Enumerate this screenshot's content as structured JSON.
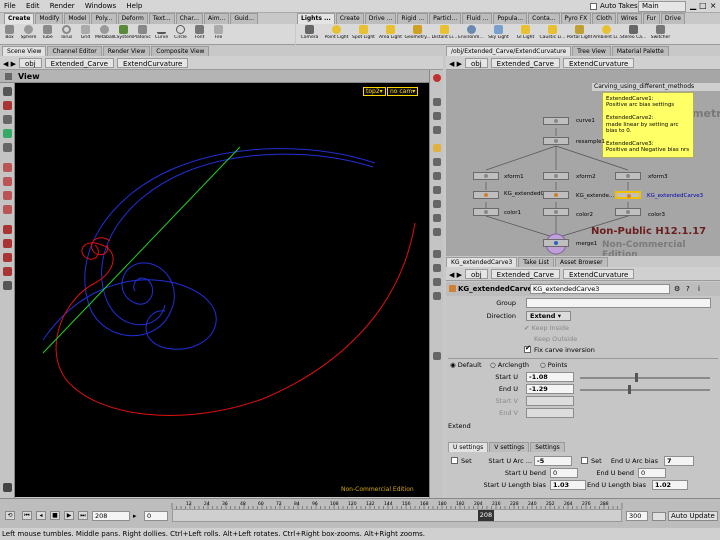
{
  "menu": [
    "File",
    "Edit",
    "Render",
    "Windows",
    "Help"
  ],
  "top_right": {
    "auto_takes": "Auto Takes",
    "desktop": "Main"
  },
  "shelf_tabs_left": [
    "Create",
    "Modify",
    "Model",
    "Poly...",
    "Deform",
    "Text...",
    "Char...",
    "Aim...",
    "Guid..."
  ],
  "shelf_tabs_right": [
    "Lights ...",
    "Create",
    "Drive ...",
    "Rigid ...",
    "Particl...",
    "Fluid ...",
    "Popula...",
    "Conta...",
    "Pyro FX",
    "Cloth",
    "Wires",
    "Fur",
    "Drive"
  ],
  "shelf_tools_left": [
    "Box",
    "Sphere",
    "Tube",
    "Torus",
    "Grid",
    "Metaball",
    "LSystem",
    "Platonic S...",
    "Curve",
    "Circle",
    "Font",
    "File"
  ],
  "shelf_tools_right": [
    "Camera",
    "Point Light",
    "Spot Light",
    "Area Light",
    "Geometry...",
    "Distant Li...",
    "Environm... Light",
    "Sky Light",
    "GI Light",
    "Caustic Li...",
    "Portal Light",
    "Ambient Li...",
    "Stereo Ca... Rig",
    "Switcher"
  ],
  "left_pane": {
    "tabs": [
      "Scene View",
      "Channel Editor",
      "Render View",
      "Composite View"
    ],
    "path": [
      "obj",
      "Extended_Carve",
      "ExtendCurvature"
    ],
    "view_title": "View",
    "camera": "top2▾",
    "no_cam": "no cam▾",
    "watermark": "Non-Commercial Edition"
  },
  "network": {
    "tabs": [
      "/obj/Extended_Carve/ExtendCurvature",
      "Tree View",
      "Material Palette"
    ],
    "path": [
      "obj",
      "Extended_Carve",
      "ExtendCurvature"
    ],
    "title": "Carving_using_different_methods",
    "sticky_note": "ExtendedCarve1:\nPositive arc bias settings\n\nExtendedCarve2:\nmade linear by setting arc bias to 0.\n\nExtendedCarve3:\nPositive and Negative bias nrs",
    "context_label": "Geometry",
    "version_label": "Non-Public H12.1.17",
    "edition_label": "Non-Commercial Edition",
    "node_labels": {
      "curve1": "curve1",
      "resample1": "resample1",
      "xform1": "xform1",
      "xform2": "xform2",
      "xform3": "xform3",
      "carve1": "KG_extendedCarve1",
      "carve2": "KG_extende...",
      "carve3": "KG_extendedCarve3",
      "color1": "color1",
      "color2": "color2",
      "color3": "color3",
      "merge1": "merge1"
    }
  },
  "parm_pane": {
    "tabs": [
      "KG_extendedCarve3",
      "Take List",
      "Asset Browser"
    ],
    "path": [
      "obj",
      "Extended_Carve",
      "ExtendCurvature"
    ],
    "node_type": "KG_extendedCarve",
    "node_name": "KG_extendedCarve3",
    "group_label": "Group",
    "direction_label": "Direction",
    "direction_value": "Extend",
    "keep_inside": "Keep Inside",
    "keep_outside": "Keep Outside",
    "fix_carve": "Fix carve inversion",
    "radio_default": "Default",
    "radio_arclength": "Arclength",
    "radio_points": "Points",
    "start_u_label": "Start U",
    "start_u": "-1.08",
    "end_u_label": "End U",
    "end_u": "-1.29",
    "start_v_label": "Start V",
    "end_v_label": "End V",
    "mode_text": "Extend",
    "subtabs": [
      "U settings",
      "V settings",
      "Settings"
    ],
    "set": "Set",
    "start_u_arc_label": "Start U Arc ...",
    "start_u_arc": "-5",
    "set2": "Set",
    "end_u_arc_label": "End U Arc bias",
    "end_u_arc": "7",
    "start_u_bend_label": "Start U bend",
    "start_u_bend": "0",
    "end_u_bend_label": "End U bend",
    "end_u_bend": "0",
    "start_u_len_label": "Start U Length bias",
    "start_u_len": "1.03",
    "end_u_len_label": "End U Length bias",
    "end_u_len": "1.02"
  },
  "timeline": {
    "frame": "208",
    "start": "0",
    "end": "300",
    "cursor": "208",
    "ticks": [
      "12",
      "24",
      "36",
      "48",
      "60",
      "72",
      "84",
      "96",
      "108",
      "120",
      "132",
      "144",
      "156",
      "168",
      "180",
      "192",
      "204",
      "216",
      "228",
      "240",
      "252",
      "264",
      "276",
      "288"
    ],
    "auto_update": "Auto Update"
  },
  "status": "Left mouse tumbles. Middle pans. Right dollies. Ctrl+Left rolls. Alt+Left rotates. Ctrl+Right box-zooms. Alt+Right zooms.",
  "colors": {
    "blue_curve": "#2030d8",
    "red_curve": "#e01010",
    "green_line": "#22d022",
    "sticky": "#ffff66",
    "viewport_bg": "#000000"
  }
}
